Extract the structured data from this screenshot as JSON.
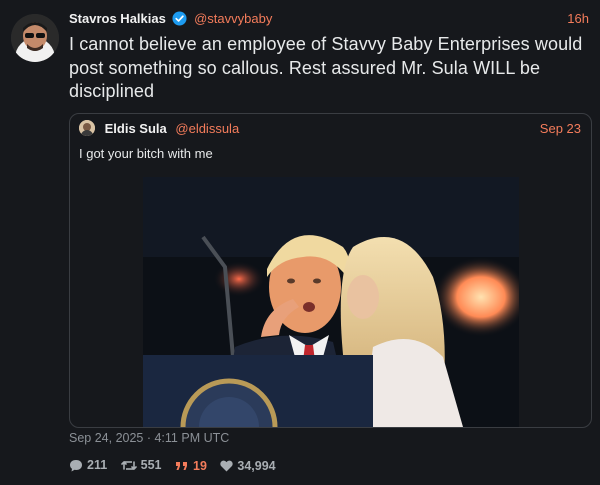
{
  "post": {
    "author_name": "Stavros Halkias",
    "author_handle": "@stavvybaby",
    "time": "16h",
    "text": "I cannot believe an employee of Stavvy Baby Enterprises would post something so callous. Rest assured Mr. Sula WILL be disciplined",
    "timestamp": "Sep 24, 2025 · 4:11 PM UTC",
    "stats": {
      "replies": "211",
      "reposts": "551",
      "quotes": "19",
      "likes": "34,994"
    }
  },
  "quoted": {
    "author_name": "Eldis Sula",
    "author_handle": "@eldissula",
    "date": "Sep 23",
    "text": "I got your bitch with me"
  },
  "colors": {
    "background": "#16181c",
    "accent": "#f47c5b",
    "verified": "#1d9bf0",
    "muted": "#8b9096"
  },
  "icons": [
    "verified-badge-icon",
    "reply-icon",
    "repost-icon",
    "quote-icon",
    "like-icon"
  ]
}
